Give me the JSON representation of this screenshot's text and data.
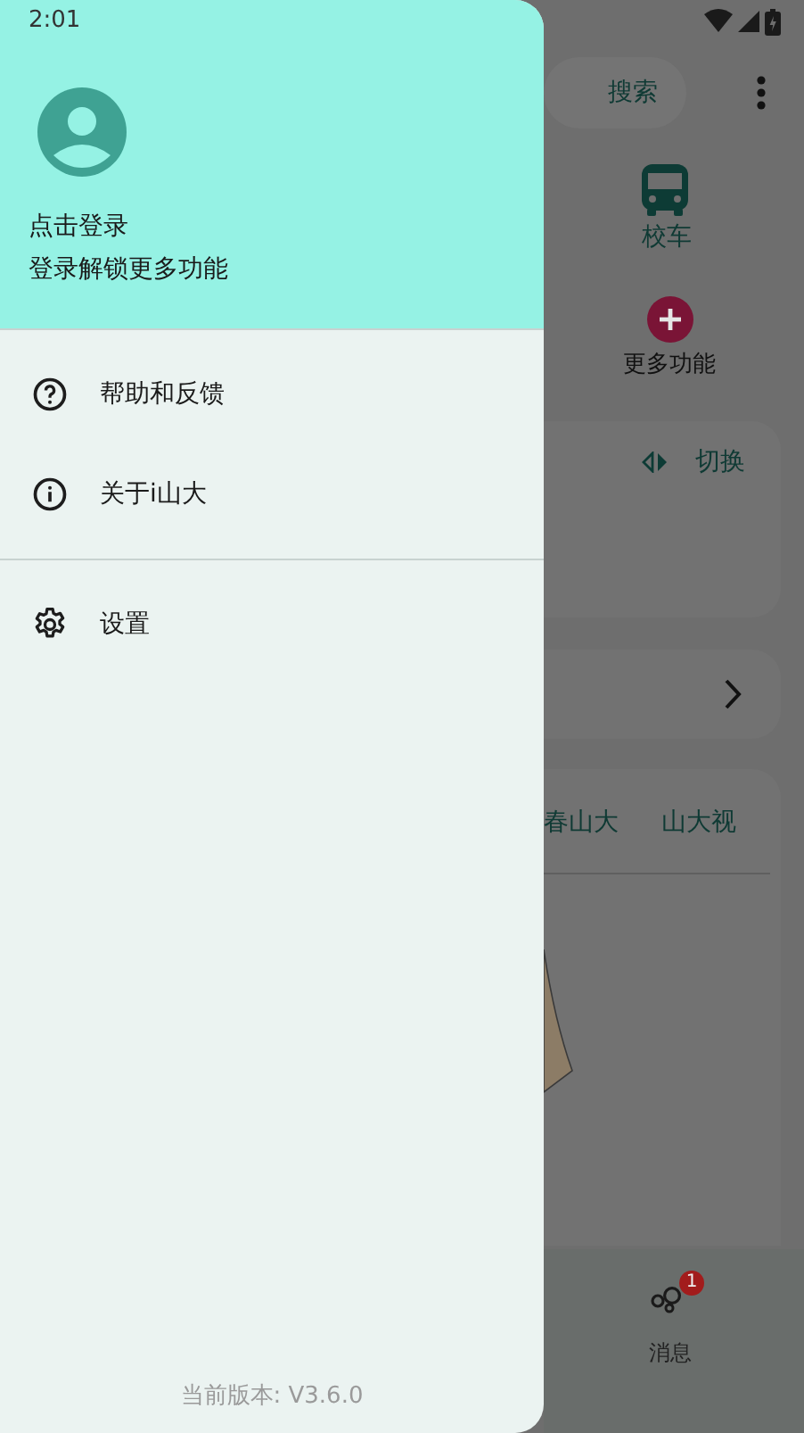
{
  "status_bar": {
    "time": "2:01"
  },
  "background_app": {
    "search_button": "搜索",
    "shortcuts": [
      {
        "label": "校车",
        "kind": "bus"
      },
      {
        "label": "更多功能",
        "kind": "add"
      }
    ],
    "schedule_card": {
      "switch_label": "切换"
    },
    "news_tabs": [
      {
        "label": "春山大"
      },
      {
        "label": "山大视"
      }
    ],
    "bottom_nav": [
      {
        "label": "消息",
        "badge": "1"
      }
    ]
  },
  "drawer": {
    "profile": {
      "title": "点击登录",
      "subtitle": "登录解锁更多功能"
    },
    "menu_groups": [
      [
        {
          "label": "帮助和反馈",
          "kind": "help"
        },
        {
          "label": "关于i山大",
          "kind": "info"
        }
      ],
      [
        {
          "label": "设置",
          "kind": "settings"
        }
      ]
    ],
    "version": "当前版本: V3.6.0"
  }
}
